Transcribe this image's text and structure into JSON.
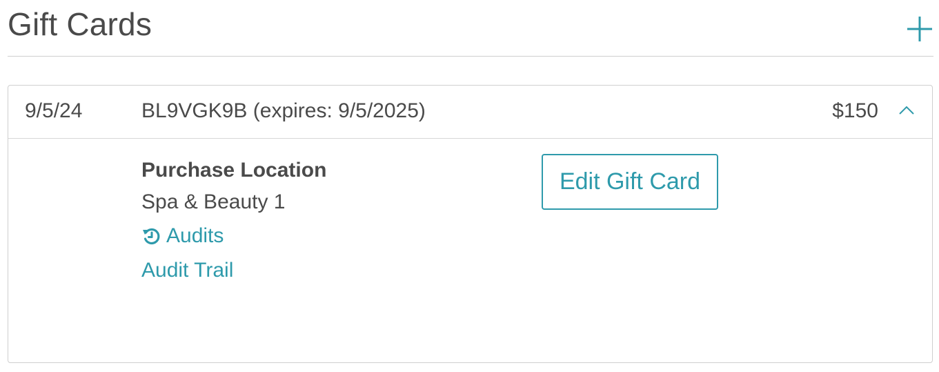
{
  "header": {
    "title": "Gift Cards",
    "add_icon": "plus-icon"
  },
  "gift_cards": [
    {
      "date": "9/5/24",
      "code": "BL9VGK9B (expires: 9/5/2025)",
      "amount": "$150",
      "toggle_icon": "chevron-up-icon",
      "expanded": true,
      "details": {
        "purchase_location_label": "Purchase Location",
        "purchase_location_value": "Spa & Beauty 1",
        "audits_icon": "history-icon",
        "audits_label": "Audits",
        "audit_trail_label": "Audit Trail",
        "edit_button_label": "Edit Gift Card"
      }
    }
  ],
  "colors": {
    "accent": "#2e9aab",
    "text": "#4a4a4a",
    "border": "#cfcfcf"
  }
}
